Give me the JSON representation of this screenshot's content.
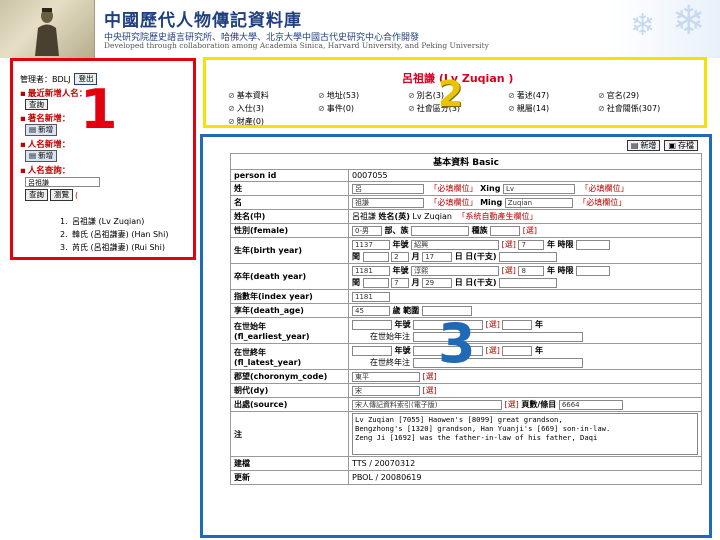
{
  "header": {
    "title": "中國歷代人物傳記資料庫",
    "subtitle": "中央研究院歷史語言研究所、哈佛大學、北京大學中國古代史研究中心合作開發",
    "subtitle_en": "Developed through collaboration among Academia Sinica, Harvard University, and Peking University"
  },
  "left_panel": {
    "admin_label": "管理者：BDLJ",
    "logout": "登出",
    "recent_label": "最近新增人名：",
    "btn_query": "查詢",
    "alt_name_label": "著名新增：",
    "btn_new": "新增",
    "person_new_label": "人名新增：",
    "person_query_label": "人名查詢：",
    "search_value": "呂祖謙",
    "btn_browse": "瀏覽",
    "paren": "(",
    "results": [
      {
        "num": "1.",
        "text": "呂祖謙 (Lv Zuqian)"
      },
      {
        "num": "2.",
        "text": "韓氏 (呂祖謙妻) (Han Shi)"
      },
      {
        "num": "3.",
        "text": "芮氏 (呂祖謙妻) (Rui Shi)"
      }
    ],
    "marker": "1"
  },
  "top_panel": {
    "title": "呂祖謙 (Lv Zuqian )",
    "marker": "2",
    "row1": [
      "基本資料",
      "地址(53)",
      "別名(3)",
      "著述(47)",
      "官名(29)"
    ],
    "row2": [
      "入仕(3)",
      "事件(0)",
      "社會區分(3)",
      "親屬(14)",
      "社會關係(307)"
    ],
    "row3": [
      "財產(0)"
    ]
  },
  "main_panel": {
    "marker": "3",
    "btn_new": "新增",
    "btn_save": "存檔",
    "header": "基本資料 Basic",
    "required": "「必填欄位」",
    "system_auto": "「系統自動產生欄位」",
    "fk": "[選]",
    "rows": {
      "person_id": {
        "label": "person id",
        "value": "0007055"
      },
      "surname": {
        "label": "姓",
        "value": "呂",
        "en_label": "Xing",
        "en_value": "Lv"
      },
      "name": {
        "label": "名",
        "value": "祖謙",
        "en_label": "Ming",
        "en_value": "Zuqian"
      },
      "fullname": {
        "label": "姓名(中)",
        "value": "呂祖謙",
        "mid_label": "姓名(英)",
        "en_value": "Lv Zuqian"
      },
      "gender": {
        "label": "性別(female)",
        "value": "0-男",
        "mid": "部、族",
        "tribe": "種族"
      },
      "birth": {
        "label": "生年(birth year)",
        "year": "1137",
        "era_label": "年號",
        "era": "紹興",
        "era_num": "7",
        "nian": "年",
        "shichen": "時限",
        "run": "閏",
        "month": "2",
        "yue": "月",
        "day": "17",
        "ri": "日",
        "ganzhi": "日(干支)"
      },
      "death": {
        "label": "卒年(death year)",
        "year": "1181",
        "era_label": "年號",
        "era": "淳熙",
        "era_num": "8",
        "nian": "年",
        "shichen": "時限",
        "run": "閏",
        "month": "7",
        "yue": "月",
        "day": "29",
        "ri": "日",
        "ganzhi": "日(干支)"
      },
      "index_year": {
        "label": "指數年(index year)",
        "value": "1181"
      },
      "death_age": {
        "label": "享年(death_age)",
        "value": "45",
        "unit": "歲",
        "range": "範圍"
      },
      "fl_earliest": {
        "label1": "在世始年",
        "label2": "(fl_earliest_year)",
        "era_label": "年號",
        "nian": "年",
        "note": "在世始年注"
      },
      "fl_latest": {
        "label1": "在世終年",
        "label2": "(fl_latest_year)",
        "era_label": "年號",
        "nian": "年",
        "note": "在世終年注"
      },
      "choronym": {
        "label": "郡望(choronym_code)",
        "value": "東平"
      },
      "dynasty": {
        "label": "朝代(dy)",
        "value": "宋"
      },
      "source": {
        "label": "出處(source)",
        "value": "宋人傳記資料索引(電子版)",
        "page_label": "頁數/條目",
        "page": "6664"
      },
      "notes": {
        "label": "注",
        "lines": [
          "Lv Zuqian [7055] Haowen's [8099] great grandson,",
          "Bengzhong's [1320] grandson, Han Yuanji's [669] son-in-law.",
          "Zeng Ji [1692] was the father-in-law of his father, Daqi"
        ]
      },
      "created": {
        "label": "建檔",
        "value": "TTS / 20070312"
      },
      "updated": {
        "label": "更新",
        "value": "PBOL / 20080619"
      }
    }
  },
  "colors": {
    "panel1": "#e3000f",
    "panel2": "#f2e400",
    "panel3": "#1f69b7",
    "required_red": "#c00000",
    "header_blue": "#1f3f80"
  }
}
